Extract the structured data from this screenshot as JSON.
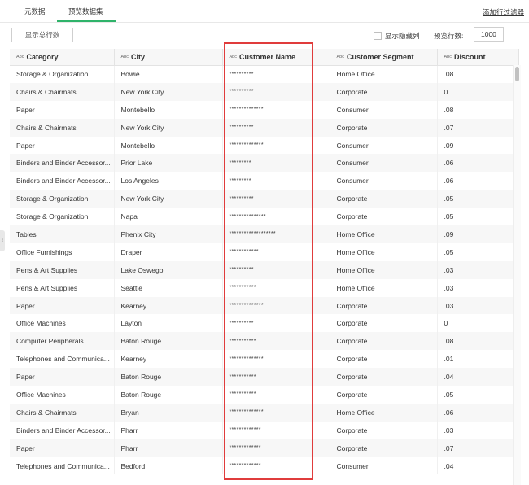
{
  "tabs": [
    {
      "label": "元数据"
    },
    {
      "label": "预览数据集"
    }
  ],
  "add_filter_label": "添加行过滤器",
  "toolbar": {
    "show_total_rows_label": "显示总行数",
    "show_hidden_cols_label": "显示隐藏列",
    "preview_rows_label": "预览行数:",
    "preview_rows_value": "1000"
  },
  "colors": {
    "accent": "#2fb36a",
    "highlight": "#e03c3c"
  },
  "table": {
    "type_tag": "Abc",
    "headers": [
      "Category",
      "City",
      "Customer Name",
      "Customer Segment",
      "Discount"
    ],
    "rows": [
      [
        "Storage & Organization",
        "Bowie",
        "**********",
        "Home Office",
        ".08"
      ],
      [
        "Chairs & Chairmats",
        "New York City",
        "**********",
        "Corporate",
        "0"
      ],
      [
        "Paper",
        "Montebello",
        "**************",
        "Consumer",
        ".08"
      ],
      [
        "Chairs & Chairmats",
        "New York City",
        "**********",
        "Corporate",
        ".07"
      ],
      [
        "Paper",
        "Montebello",
        "**************",
        "Consumer",
        ".09"
      ],
      [
        "Binders and Binder Accessor...",
        "Prior Lake",
        "*********",
        "Consumer",
        ".06"
      ],
      [
        "Binders and Binder Accessor...",
        "Los Angeles",
        "*********",
        "Consumer",
        ".06"
      ],
      [
        "Storage & Organization",
        "New York City",
        "**********",
        "Corporate",
        ".05"
      ],
      [
        "Storage & Organization",
        "Napa",
        "***************",
        "Corporate",
        ".05"
      ],
      [
        "Tables",
        "Phenix City",
        "*******************",
        "Home Office",
        ".09"
      ],
      [
        "Office Furnishings",
        "Draper",
        "************",
        "Home Office",
        ".05"
      ],
      [
        "Pens & Art Supplies",
        "Lake Oswego",
        "**********",
        "Home Office",
        ".03"
      ],
      [
        "Pens & Art Supplies",
        "Seattle",
        "***********",
        "Home Office",
        ".03"
      ],
      [
        "Paper",
        "Kearney",
        "**************",
        "Corporate",
        ".03"
      ],
      [
        "Office Machines",
        "Layton",
        "**********",
        "Corporate",
        "0"
      ],
      [
        "Computer Peripherals",
        "Baton Rouge",
        "***********",
        "Corporate",
        ".08"
      ],
      [
        "Telephones and Communica...",
        "Kearney",
        "**************",
        "Corporate",
        ".01"
      ],
      [
        "Paper",
        "Baton Rouge",
        "***********",
        "Corporate",
        ".04"
      ],
      [
        "Office Machines",
        "Baton Rouge",
        "***********",
        "Corporate",
        ".05"
      ],
      [
        "Chairs & Chairmats",
        "Bryan",
        "**************",
        "Home Office",
        ".06"
      ],
      [
        "Binders and Binder Accessor...",
        "Pharr",
        "*************",
        "Corporate",
        ".03"
      ],
      [
        "Paper",
        "Pharr",
        "*************",
        "Corporate",
        ".07"
      ],
      [
        "Telephones and Communica...",
        "Bedford",
        "*************",
        "Consumer",
        ".04"
      ]
    ]
  }
}
